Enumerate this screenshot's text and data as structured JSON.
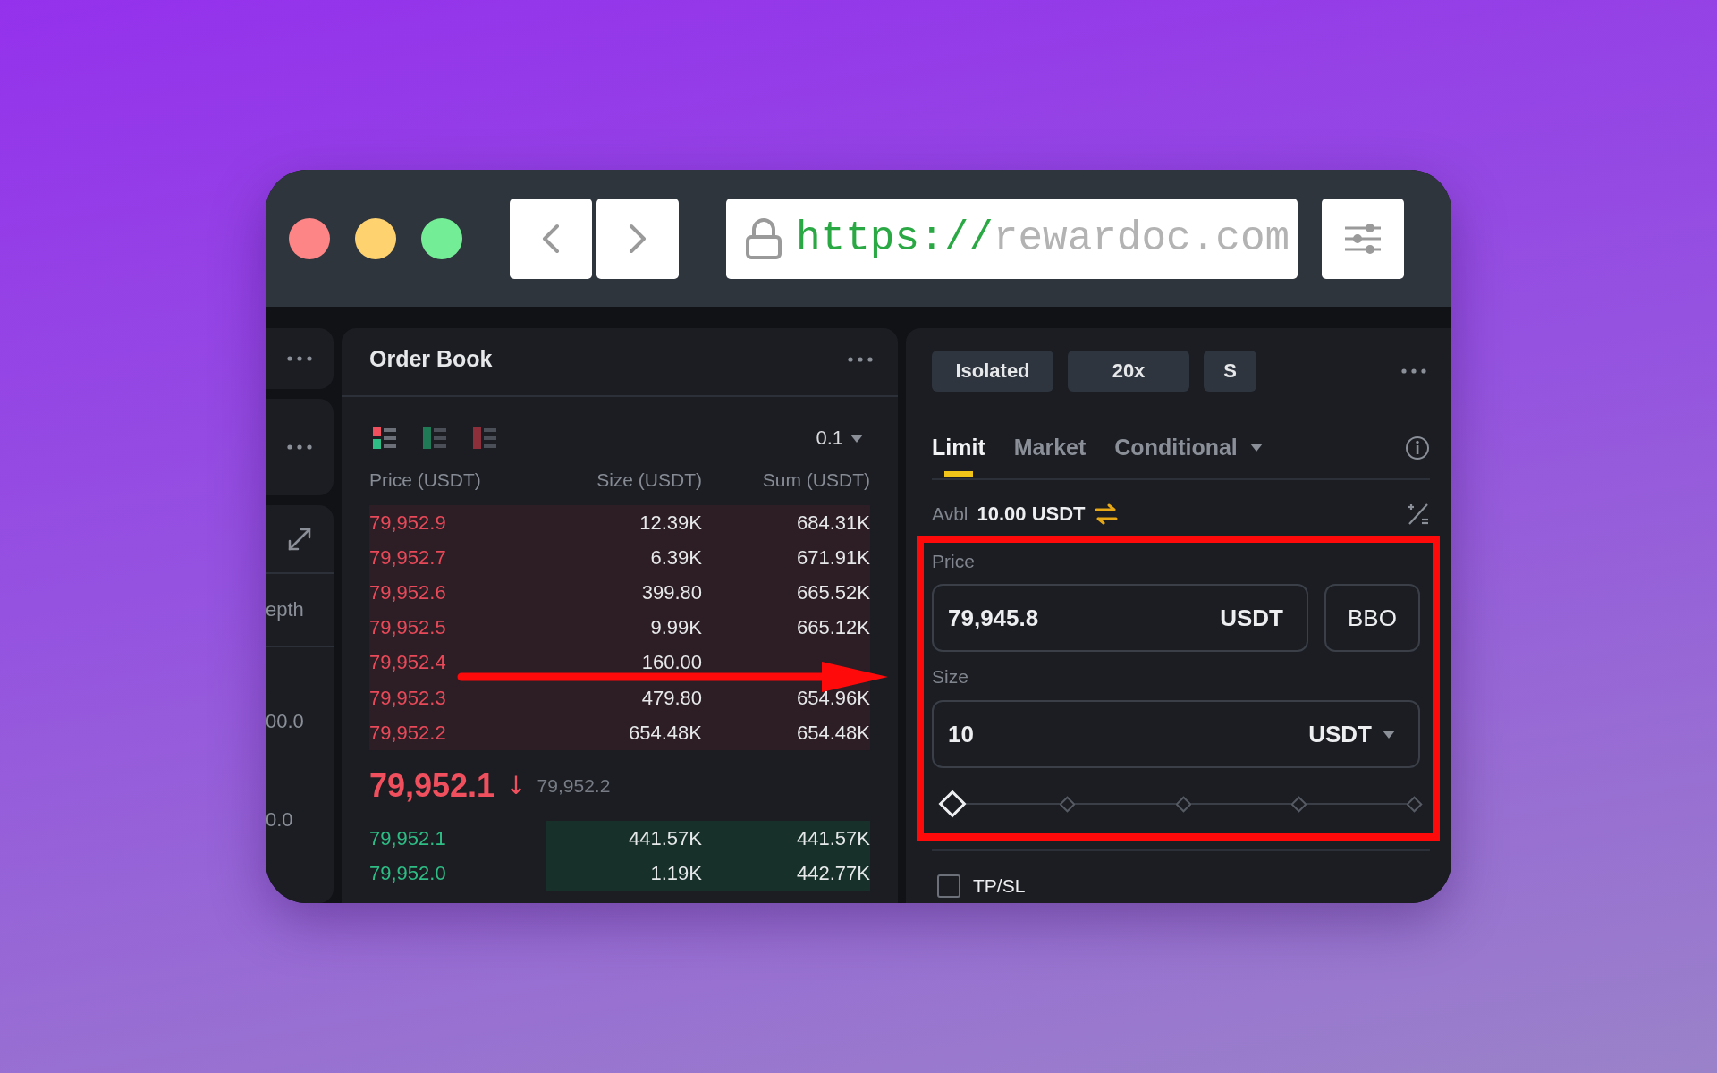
{
  "browser": {
    "url_scheme": "https://",
    "url_host": "rewardoc.com"
  },
  "side_panel": {
    "tab_label": "epth",
    "values": [
      "00.0",
      "0.0"
    ]
  },
  "order_book": {
    "title": "Order Book",
    "tick": "0.1",
    "columns": [
      "Price (USDT)",
      "Size (USDT)",
      "Sum (USDT)"
    ],
    "asks": [
      {
        "price": "79,952.9",
        "size": "12.39K",
        "sum": "684.31K"
      },
      {
        "price": "79,952.7",
        "size": "6.39K",
        "sum": "671.91K"
      },
      {
        "price": "79,952.6",
        "size": "399.80",
        "sum": "665.52K"
      },
      {
        "price": "79,952.5",
        "size": "9.99K",
        "sum": "665.12K"
      },
      {
        "price": "79,952.4",
        "size": "160.00"
      },
      {
        "price": "79,952.3",
        "size": "479.80",
        "sum": "654.96K"
      },
      {
        "price": "79,952.2",
        "size": "654.48K",
        "sum": "654.48K"
      }
    ],
    "last_price": "79,952.1",
    "trend_arrow": "↓",
    "mark_price": "79,952.2",
    "bids": [
      {
        "price": "79,952.1",
        "size": "441.57K",
        "sum": "441.57K"
      },
      {
        "price": "79,952.0",
        "size": "1.19K",
        "sum": "442.77K"
      }
    ]
  },
  "order_form": {
    "margin_mode": "Isolated",
    "leverage": "20x",
    "position_side": "S",
    "order_types": [
      {
        "label": "Limit",
        "selected": true,
        "dropdown": false
      },
      {
        "label": "Market",
        "selected": false,
        "dropdown": false
      },
      {
        "label": "Conditional",
        "selected": false,
        "dropdown": true
      }
    ],
    "available_label": "Avbl",
    "available": "10.00 USDT",
    "price_label": "Price",
    "price": "79,945.8",
    "price_unit": "USDT",
    "bbo": "BBO",
    "size_label": "Size",
    "size": "10",
    "size_unit": "USDT",
    "size_slider": {
      "level": 0
    },
    "tpsl": {
      "label": "TP/SL",
      "checked": false
    }
  }
}
